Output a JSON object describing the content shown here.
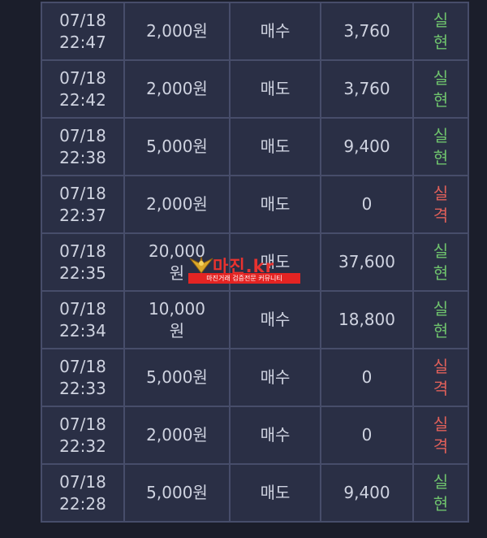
{
  "rows": [
    {
      "date": "07/18",
      "time": "22:47",
      "amount": "2,000원",
      "amount_lines": [],
      "type": "매수",
      "value": "3,760",
      "result": [
        "실",
        "현"
      ],
      "status": "win"
    },
    {
      "date": "07/18",
      "time": "22:42",
      "amount": "2,000원",
      "amount_lines": [],
      "type": "매도",
      "value": "3,760",
      "result": [
        "실",
        "현"
      ],
      "status": "win"
    },
    {
      "date": "07/18",
      "time": "22:38",
      "amount": "5,000원",
      "amount_lines": [],
      "type": "매도",
      "value": "9,400",
      "result": [
        "실",
        "현"
      ],
      "status": "win"
    },
    {
      "date": "07/18",
      "time": "22:37",
      "amount": "2,000원",
      "amount_lines": [],
      "type": "매도",
      "value": "0",
      "result": [
        "실",
        "격"
      ],
      "status": "lose"
    },
    {
      "date": "07/18",
      "time": "22:35",
      "amount": "",
      "amount_lines": [
        "20,000",
        "원"
      ],
      "type": "매도",
      "value": "37,600",
      "result": [
        "실",
        "현"
      ],
      "status": "win"
    },
    {
      "date": "07/18",
      "time": "22:34",
      "amount": "",
      "amount_lines": [
        "10,000",
        "원"
      ],
      "type": "매수",
      "value": "18,800",
      "result": [
        "실",
        "현"
      ],
      "status": "win"
    },
    {
      "date": "07/18",
      "time": "22:33",
      "amount": "5,000원",
      "amount_lines": [],
      "type": "매수",
      "value": "0",
      "result": [
        "실",
        "격"
      ],
      "status": "lose"
    },
    {
      "date": "07/18",
      "time": "22:32",
      "amount": "2,000원",
      "amount_lines": [],
      "type": "매수",
      "value": "0",
      "result": [
        "실",
        "격"
      ],
      "status": "lose"
    },
    {
      "date": "07/18",
      "time": "22:28",
      "amount": "5,000원",
      "amount_lines": [],
      "type": "매도",
      "value": "9,400",
      "result": [
        "실",
        "현"
      ],
      "status": "win"
    }
  ],
  "colors": {
    "win": "#6fc36d",
    "lose": "#e0605a"
  },
  "watermark": {
    "title": "마진.kr",
    "subtitle": "마진거래 검증전문 커뮤니티"
  }
}
